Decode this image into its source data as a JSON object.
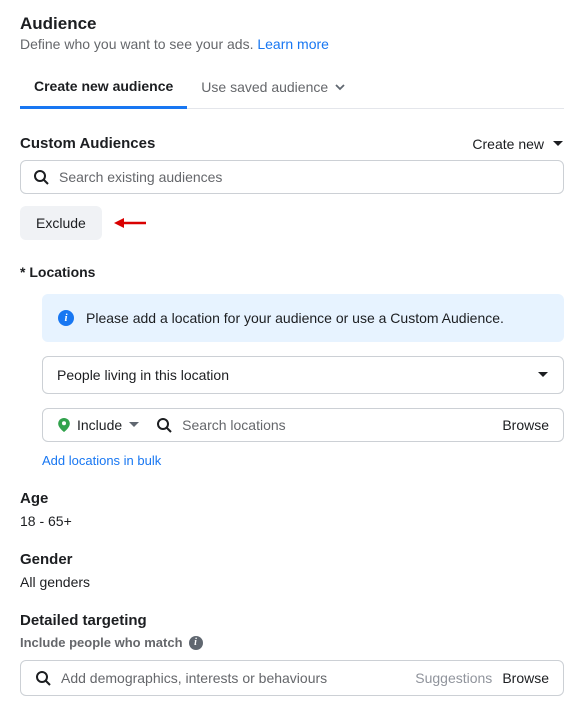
{
  "header": {
    "title": "Audience",
    "subtitle_prefix": "Define who you want to see your ads. ",
    "learn_more": "Learn more"
  },
  "tabs": {
    "create": "Create new audience",
    "saved": "Use saved audience"
  },
  "custom_audiences": {
    "label": "Custom Audiences",
    "create_new": "Create new",
    "search_placeholder": "Search existing audiences",
    "exclude": "Exclude"
  },
  "locations": {
    "label": "* Locations",
    "banner": "Please add a location for your audience or use a Custom Audience.",
    "scope": "People living in this location",
    "include": "Include",
    "search_placeholder": "Search locations",
    "browse": "Browse",
    "bulk": "Add locations in bulk"
  },
  "age": {
    "label": "Age",
    "value": "18 - 65+"
  },
  "gender": {
    "label": "Gender",
    "value": "All genders"
  },
  "detailed": {
    "label": "Detailed targeting",
    "sub": "Include people who match",
    "placeholder": "Add demographics, interests or behaviours",
    "suggestions": "Suggestions",
    "browse": "Browse"
  }
}
